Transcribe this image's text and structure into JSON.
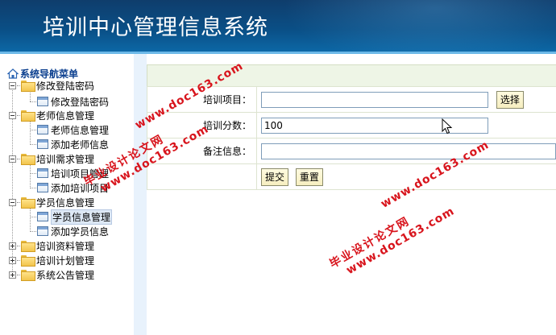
{
  "header": {
    "title": "培训中心管理信息系统"
  },
  "sidebar": {
    "root_label": "系统导航菜单",
    "groups": [
      {
        "label": "修改登陆密码",
        "expanded": true,
        "items": [
          "修改登陆密码"
        ]
      },
      {
        "label": "老师信息管理",
        "expanded": true,
        "items": [
          "老师信息管理",
          "添加老师信息"
        ]
      },
      {
        "label": "培训需求管理",
        "expanded": true,
        "items": [
          "培训项目管理",
          "添加培训项目"
        ]
      },
      {
        "label": "学员信息管理",
        "expanded": true,
        "items": [
          "学员信息管理",
          "添加学员信息"
        ],
        "selected_item": "学员信息管理"
      },
      {
        "label": "培训资料管理",
        "expanded": false
      },
      {
        "label": "培训计划管理",
        "expanded": false
      },
      {
        "label": "系统公告管理",
        "expanded": false
      }
    ]
  },
  "form": {
    "fields": [
      {
        "label": "培训项目：",
        "value": "",
        "button": "选择"
      },
      {
        "label": "培训分数：",
        "value": "100"
      },
      {
        "label": "备注信息：",
        "value": ""
      }
    ],
    "submit_label": "提交",
    "reset_label": "重置"
  },
  "watermark": {
    "line1": "毕业设计论文网",
    "line2": "www.doc163.com"
  },
  "colors": {
    "header_dark": "#0f3d6c",
    "header_light": "#0d6aa9",
    "watermark": "#d8141c",
    "form_header": "#eef5e6"
  }
}
